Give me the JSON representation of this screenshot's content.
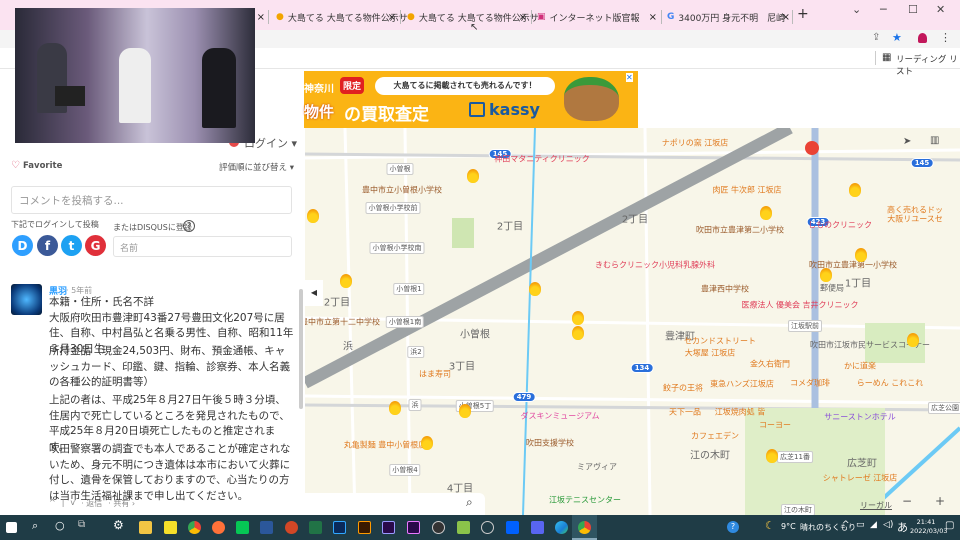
{
  "browser": {
    "tabs": [
      {
        "label": "大島てる 大島てる物件公示サ"
      },
      {
        "label": "大島てる 大島てる物件公示サ"
      },
      {
        "label": "インターネット版官報"
      },
      {
        "label": "3400万円 身元不明　尼崎"
      }
    ],
    "tab_close": "×",
    "new_tab": "+",
    "reading_list": "リーディング リスト"
  },
  "ad": {
    "region": "神奈川",
    "badge": "限定",
    "bubble": "大島てるに掲載されても売れるんです！",
    "headline_left": "物件",
    "headline": "の買取査定",
    "brand": "kassy",
    "close": "✕"
  },
  "comments": {
    "login": "ログイン",
    "favorite": "Favorite",
    "sort": "評価順に並び替え",
    "comment_placeholder": "コメントを投稿する...",
    "login_prompt": "下記でログインして投稿",
    "disqus_register": "またはDISQUSに登録",
    "help": "?",
    "name_placeholder": "名前",
    "social": [
      "D",
      "f",
      "t",
      "G"
    ],
    "comment": {
      "author": "黒羽",
      "time": "· 5年前",
      "paragraphs": [
        "本籍・住所・氏名不詳\n大阪府吹田市豊津町43番27号豊田文化207号に居住、自称、中村昌弘と名乗る男性、自称、昭和11年３月30日生",
        "所持金品（現金24,503円、財布、預金通帳、キャッシュカード、印鑑、鍵、指輪、診察券、本人名義の各種公的証明書等）",
        "上記の者は、平成25年８月27日午後５時３分頃、住居内で死亡しているところを発見されたもので、平成25年８月20日頃死亡したものと推定されます。",
        "吹田警察署の調査でも本人であることが確定されないため、身元不明につき遺体は本市において火葬に付し、遺骨を保管しておりますので、心当たりの方は当市生活福祉課まで申し出てください。"
      ],
      "actions": {
        "up": "^",
        "down": "v",
        "reply": "· 返信",
        "share": "· 共有 ›"
      }
    }
  },
  "map": {
    "labels": [
      "145",
      "神田マタニティクリニック",
      "小曽根",
      "豊中市立小曽根小学校",
      "小曽根小学校前",
      "2丁目",
      "小曽根小学校南",
      "小曽根1",
      "2丁目",
      "ナポリの窯 江坂店",
      "145",
      "肉匠 牛次郎 江坂店",
      "423",
      "高く売れるドッ",
      "大阪リユースセ",
      "しものクリニック",
      "吹田市立豊津第二小学校",
      "きむらクリニック小児科乳腺外科",
      "吹田市立豊津第一小学校",
      "1丁目",
      "郵便局",
      "豊津西中学校",
      "医療法人 優美会 吉井クリニック",
      "豊中市立第十二中学校",
      "小曽根1南",
      "小曽根",
      "浜",
      "浜2",
      "3丁目",
      "はま寿司",
      "浜",
      "小曽根5丁",
      "479",
      "ダスキンミュージアム",
      "丸亀製麺 豊中小曽根店",
      "吹田支援学校",
      "ミアヴィア",
      "小曽根4",
      "4丁目",
      "江坂テニスセンター",
      "豊津町",
      "セカンドストリート",
      "江坂駅前",
      "吹田市江坂市民サービスコーナー",
      "大塚屋 江坂店",
      "金久右衛門",
      "かに道楽",
      "134",
      "東急ハンズ江坂店",
      "コメダ珈琲",
      "らーめん これこれ",
      "餃子の王将",
      "天下一品",
      "江坂焼肉処 皆",
      "サニーストンホテル",
      "広芝公園",
      "コーヨー",
      "カフェエデン",
      "江の木町",
      "広芝11番",
      "広芝町",
      "シャトレーゼ 江坂店",
      "江の木町",
      "2丁目"
    ],
    "legal": "リーガル",
    "zoom_in": "+",
    "zoom_out": "−",
    "collapse": "◀"
  },
  "taskbar": {
    "apps": [
      "start",
      "search",
      "cortana",
      "task-view",
      "settings",
      "explorer",
      "sticky-notes",
      "chrome",
      "firefox",
      "line",
      "word",
      "powerpoint",
      "excel",
      "photoshop",
      "illustrator",
      "premiere-alt",
      "premiere",
      "obs",
      "player",
      "xbox",
      "dropbox",
      "discord",
      "edge",
      "chrome-active"
    ],
    "help": "?",
    "weather_temp": "9°C",
    "weather_text": "晴れのちくもり",
    "ime": "あ",
    "time": "21:41",
    "date": "2022/03/03"
  },
  "colors": {
    "tabbar": "#fbe3f1",
    "taskbar": "#1f3c46",
    "map_bg": "#f8f6e9",
    "ad": "#fbb414"
  }
}
